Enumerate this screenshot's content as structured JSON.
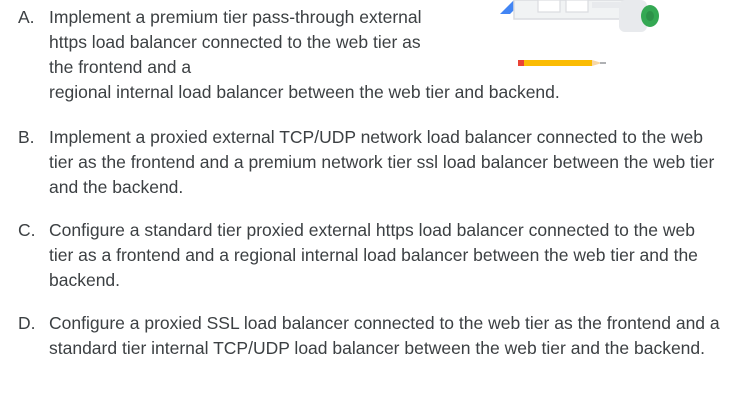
{
  "options": [
    {
      "letter": "A.",
      "text_lead": "Implement a premium tier pass-through external https load balancer connected to the web tier as the frontend and a",
      "text_tail": "regional internal load balancer between the web tier and backend."
    },
    {
      "letter": "B.",
      "text": "Implement a proxied external TCP/UDP network load balancer connected to the web tier as the frontend and a premium network tier ssl load balancer between the web tier and the backend."
    },
    {
      "letter": "C.",
      "text": "Configure a standard tier proxied external https load balancer connected to the web tier as a frontend and a regional internal load balancer between the web tier and the backend."
    },
    {
      "letter": "D.",
      "text": "Configure a proxied SSL load balancer connected to the web tier as the frontend and a standard tier internal TCP/UDP load balancer between the web tier and the backend."
    }
  ],
  "illustration": {
    "icon": "laptop-coffee-pencil-illustration",
    "colors": {
      "blue": "#4285f4",
      "green": "#34a853",
      "yellow": "#fbbc04",
      "red": "#ea4335",
      "gray": "#dadce0"
    }
  }
}
